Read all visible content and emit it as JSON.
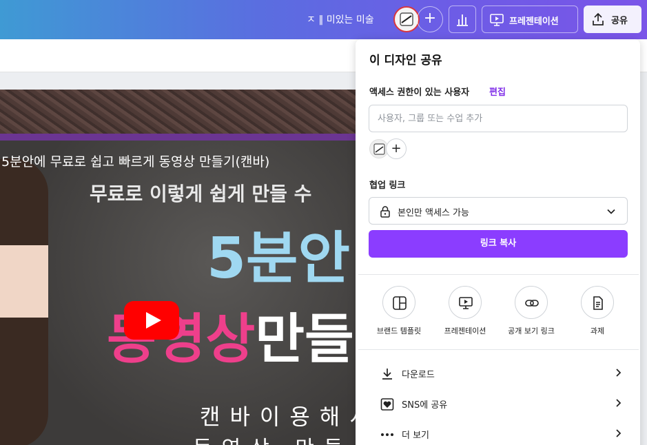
{
  "topbar": {
    "doc_title": "ㅈ ‖ 미있는 미술",
    "add_label": "+",
    "present_label": "프레젠테이션",
    "share_label": "공유"
  },
  "video": {
    "title": "5분안에 무료로 쉽고 빠르게 동영상 만들기(캔바)",
    "subtitle": "무료로 이렇게 쉽게 만들 수",
    "big_line1": "5분안",
    "big_line2_pink": "동영상",
    "big_line2_white": "만들",
    "line3": "캔바이용해서",
    "line4": "동영상 만들"
  },
  "share_panel": {
    "title": "이 디자인 공유",
    "access_label": "액세스 권한이 있는 사용자",
    "edit_label": "편집",
    "user_input_placeholder": "사용자, 그룹 또는 수업 추가",
    "add_label": "+",
    "collab_label": "협업 링크",
    "access_value": "본인만 액세스 가능",
    "copy_label": "링크 복사",
    "options": [
      {
        "label": "브랜드 템플릿",
        "icon": "brand-template-icon"
      },
      {
        "label": "프레젠테이션",
        "icon": "presentation-icon"
      },
      {
        "label": "공개 보기 링크",
        "icon": "link-icon"
      },
      {
        "label": "과제",
        "icon": "assignment-icon"
      }
    ],
    "rows": [
      {
        "label": "다운로드",
        "icon": "download-icon"
      },
      {
        "label": "SNS에 공유",
        "icon": "heart-icon"
      },
      {
        "label": "더 보기",
        "icon": "more-icon"
      }
    ]
  },
  "colors": {
    "accent": "#8b3dff",
    "edit_link": "#7d2ae8",
    "youtube_red": "#ff0000"
  }
}
